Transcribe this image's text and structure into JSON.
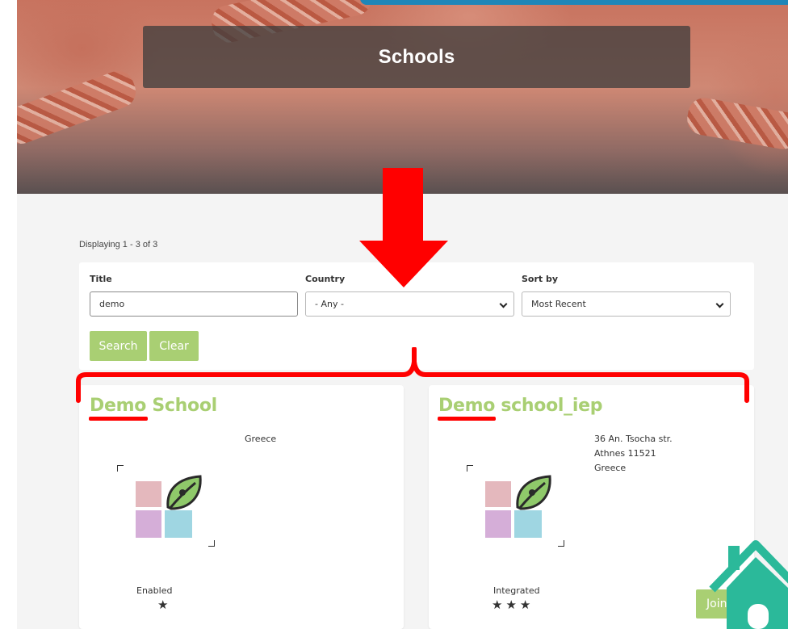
{
  "hero": {
    "title": "Schools"
  },
  "results": {
    "displaying": "Displaying 1 - 3 of 3"
  },
  "filters": {
    "title_label": "Title",
    "title_value": "demo",
    "country_label": "Country",
    "country_value": "- Any -",
    "sort_label": "Sort by",
    "sort_value": "Most Recent",
    "search_label": "Search",
    "clear_label": "Clear"
  },
  "cards": [
    {
      "title": "Demo School",
      "address": [
        "Greece"
      ],
      "status": "Enabled",
      "stars": "★"
    },
    {
      "title": "Demo school_iep",
      "address": [
        "36 An. Tsocha str.",
        "Athnes 11521",
        "Greece"
      ],
      "status": "Integrated",
      "stars": "★★★",
      "join_label": "Join"
    }
  ],
  "colors": {
    "accent": "#a9cf73",
    "annotation": "#ff0000",
    "title_bar": "#3c3c3c",
    "home_icon": "#2bb99a"
  },
  "icons": [
    "chevron-down-icon",
    "school-logo-icon",
    "star-icon",
    "home-icon",
    "down-arrow-annotation",
    "brace-annotation"
  ]
}
